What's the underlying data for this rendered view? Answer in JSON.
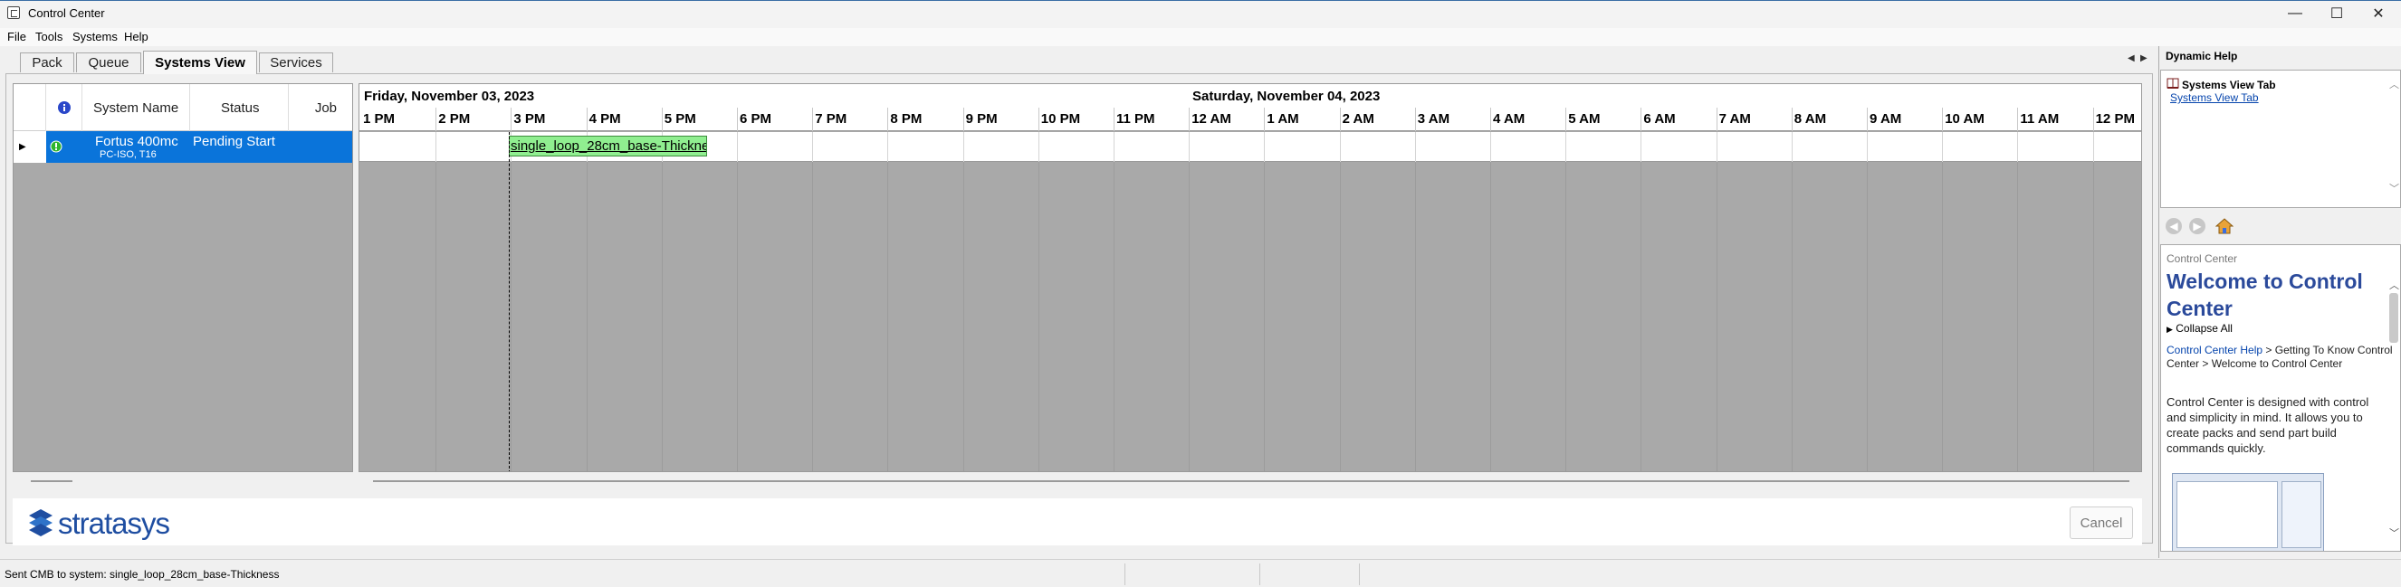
{
  "window": {
    "title": "Control Center",
    "minimize": "—",
    "maximize": "☐",
    "close": "✕"
  },
  "menu": [
    "File",
    "Tools",
    "Systems",
    "Help"
  ],
  "tabs": [
    "Pack",
    "Queue",
    "Systems View",
    "Services"
  ],
  "grid": {
    "columns": [
      "System Name",
      "Status",
      "Job"
    ],
    "rows": [
      {
        "system_name": "Fortus 400mc",
        "system_sub": "PC-ISO, T16",
        "status": "Pending Start",
        "job": ""
      }
    ]
  },
  "gantt": {
    "days": [
      "Friday, November 03, 2023",
      "Saturday, November 04, 2023"
    ],
    "hours": [
      "1 PM",
      "2 PM",
      "3 PM",
      "4 PM",
      "5 PM",
      "6 PM",
      "7 PM",
      "8 PM",
      "9 PM",
      "10 PM",
      "11 PM",
      "12 AM",
      "1 AM",
      "2 AM",
      "3 AM",
      "4 AM",
      "5 AM",
      "6 AM",
      "7 AM",
      "8 AM",
      "9 AM",
      "10 AM",
      "11 AM",
      "12 PM"
    ],
    "job_label": "single_loop_28cm_base-Thickne"
  },
  "footer": {
    "brand": "stratasys",
    "cancel": "Cancel"
  },
  "status": {
    "text": "Sent CMB to system: single_loop_28cm_base-Thickness"
  },
  "help": {
    "title": "Dynamic Help",
    "top_heading": "Systems View Tab",
    "top_link": "Systems View Tab",
    "breadcrumb_head": "Control Center",
    "heading": "Welcome to Control Center",
    "collapse": "Collapse All",
    "crumb_link": "Control Center Help",
    "crumb_rest": " > Getting To Know Control Center > Welcome to Control Center",
    "body": "Control Center is designed with control and simplicity in mind. It allows you to create packs and send part build commands quickly."
  },
  "colors": {
    "selection": "#0a74da",
    "job_bar": "#90ee90",
    "help_heading": "#2b4a9b",
    "link": "#0645ad"
  }
}
